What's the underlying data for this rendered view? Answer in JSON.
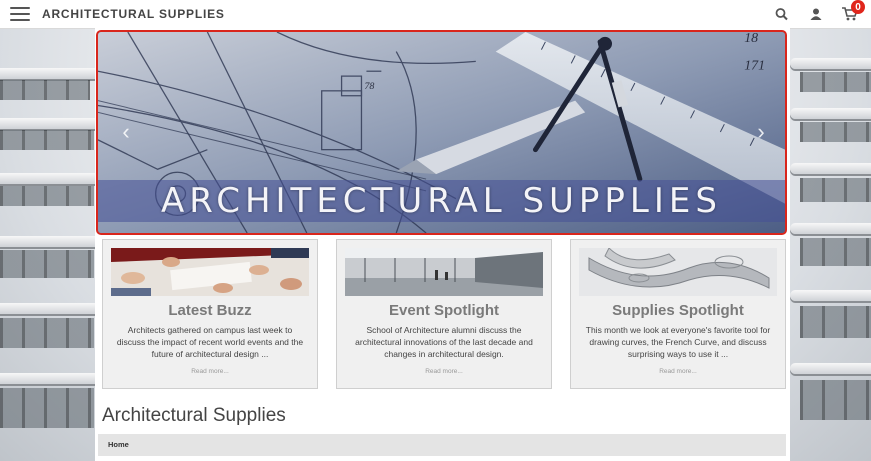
{
  "header": {
    "brand": "ARCHITECTURAL SUPPLIES",
    "menu_icon": "hamburger-menu-icon",
    "icons": [
      "search-icon",
      "user-icon",
      "cart-icon"
    ],
    "cart_count": "0"
  },
  "hero": {
    "title": "ARCHITECTURAL SUPPLIES",
    "prev_icon": "chevron-left-icon",
    "next_icon": "chevron-right-icon",
    "border_color": "#d9261c"
  },
  "cards": [
    {
      "title": "Latest Buzz",
      "body": "Architects gathered on campus last week to discuss the impact of recent world events and the future of architectural design ...",
      "more": "Read more..."
    },
    {
      "title": "Event Spotlight",
      "body": "School of Architecture alumni discuss the architectural innovations of the last decade and changes in architectural design.",
      "more": "Read more..."
    },
    {
      "title": "Supplies Spotlight",
      "body": "This month we look at everyone's favorite tool for drawing curves, the French Curve, and discuss surprising ways to use it ...",
      "more": "Read more..."
    }
  ],
  "page_title": "Architectural Supplies",
  "breadcrumb": "Home",
  "colors": {
    "accent": "#e0261c",
    "panel": "#ffffff",
    "card": "#f0f0f0"
  }
}
